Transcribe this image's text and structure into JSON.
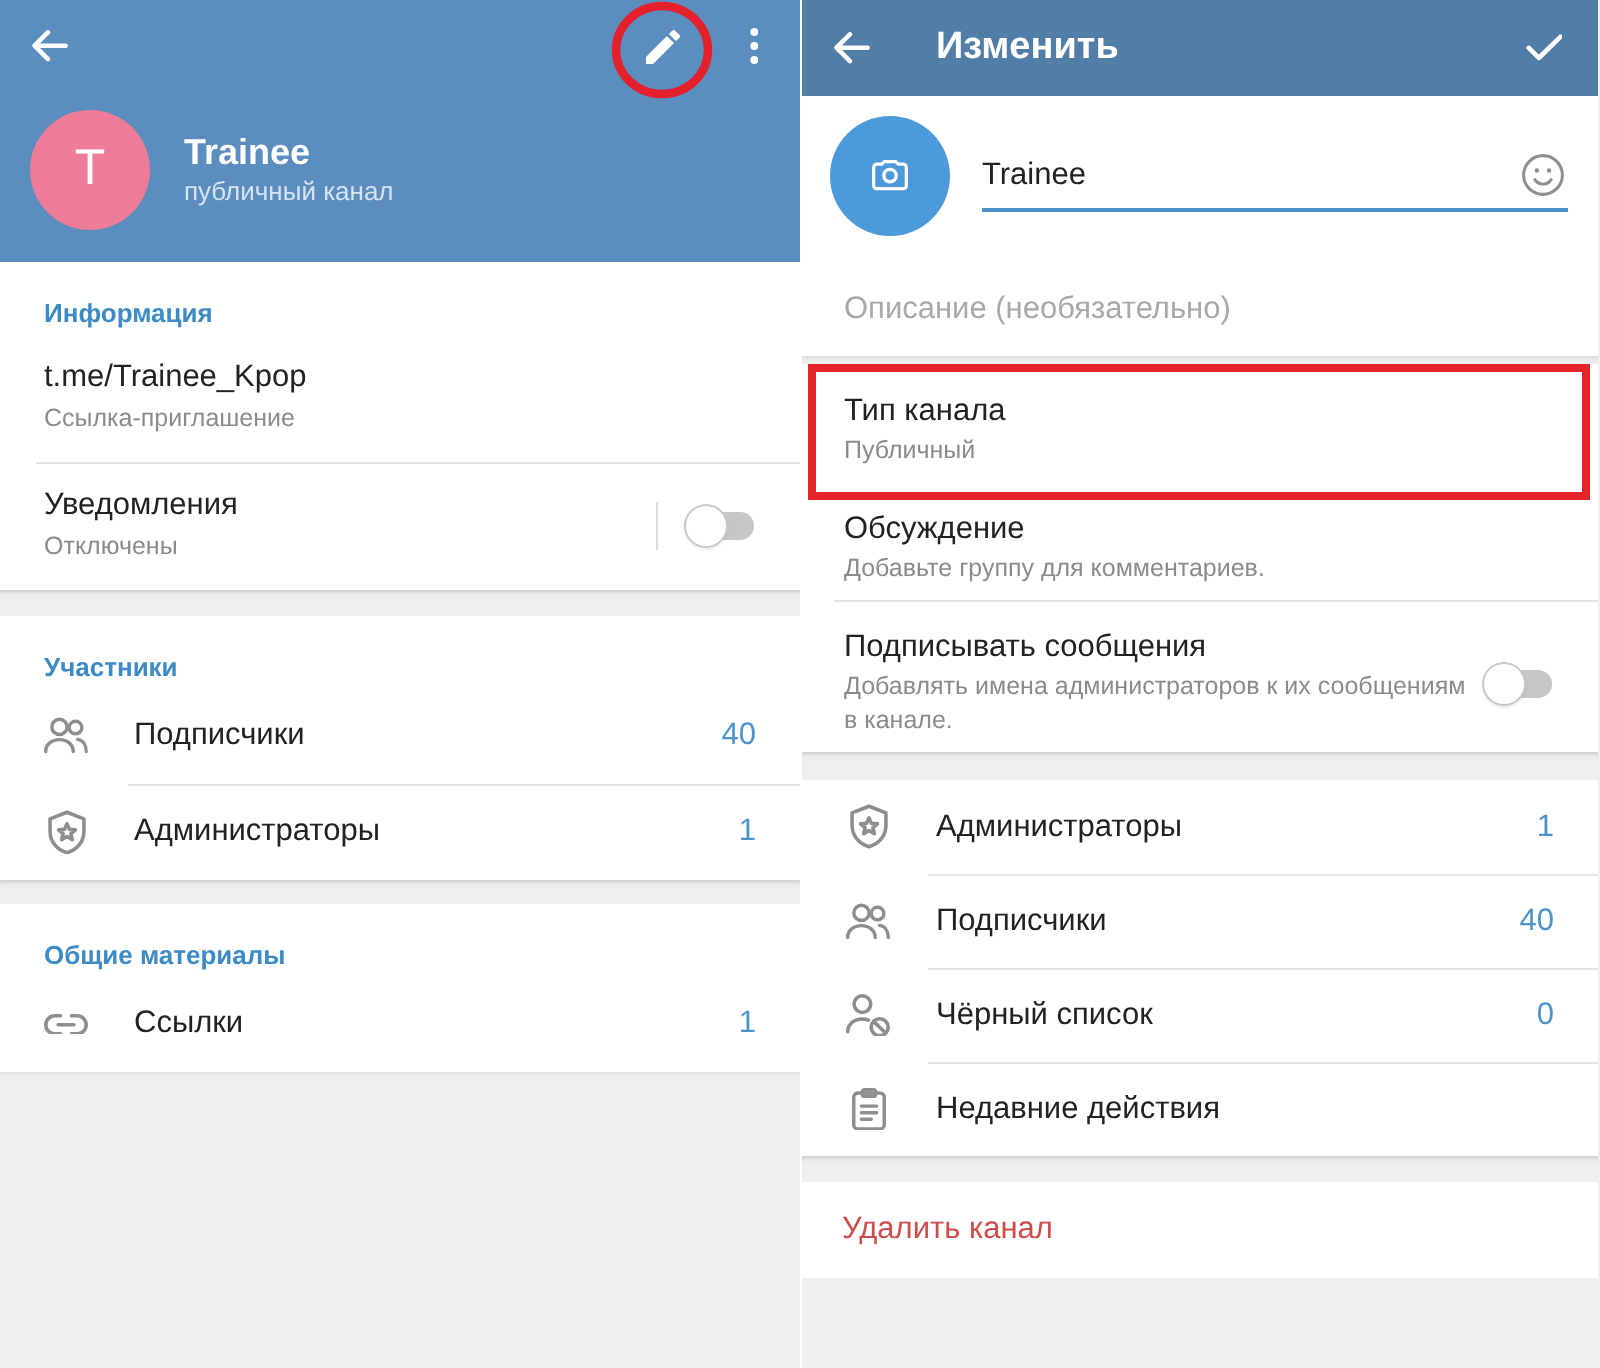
{
  "info_screen": {
    "toolbar": {
      "actions": [
        {
          "kind": "edit",
          "highlighted": true
        },
        {
          "kind": "more",
          "highlighted": false
        }
      ]
    },
    "profile": {
      "initial": "T",
      "name": "Trainee",
      "subtitle": "публичный канал"
    },
    "sections": [
      {
        "title": "Информация",
        "items": [
          {
            "kind": "info",
            "title": "t.me/Trainee_Kpop",
            "subtitle": "Ссылка-приглашение"
          },
          {
            "kind": "split_toggle",
            "title": "Уведомления",
            "subtitle": "Отключены",
            "on": false
          }
        ]
      },
      {
        "title": "Участники",
        "items": [
          {
            "kind": "subscribers",
            "title": "Подписчики",
            "count": "40"
          },
          {
            "kind": "admins",
            "title": "Администраторы",
            "count": "1"
          }
        ]
      },
      {
        "title": "Общие материалы",
        "items": [
          {
            "kind": "links",
            "title": "Ссылки",
            "count": "1"
          }
        ]
      }
    ]
  },
  "edit_screen": {
    "toolbar": {
      "title": "Изменить"
    },
    "name_field": {
      "value": "Trainee"
    },
    "description_field": {
      "placeholder": "Описание (необязательно)"
    },
    "settings": [
      {
        "kind": "detail",
        "title": "Тип канала",
        "subtitle": "Публичный",
        "highlighted": true
      },
      {
        "kind": "detail",
        "title": "Обсуждение",
        "subtitle": "Добавьте группу для комментариев.",
        "highlighted": false
      },
      {
        "kind": "toggle",
        "title": "Подписывать сообщения",
        "subtitle": "Добавлять имена администраторов к их сообщениям в канале.",
        "on": false,
        "highlighted": false
      }
    ],
    "management": [
      {
        "kind": "admins",
        "title": "Администраторы",
        "count": "1"
      },
      {
        "kind": "subscribers",
        "title": "Подписчики",
        "count": "40"
      },
      {
        "kind": "banned",
        "title": "Чёрный список",
        "count": "0"
      },
      {
        "kind": "log",
        "title": "Недавние действия"
      }
    ],
    "delete_button": {
      "label": "Удалить канал"
    }
  }
}
